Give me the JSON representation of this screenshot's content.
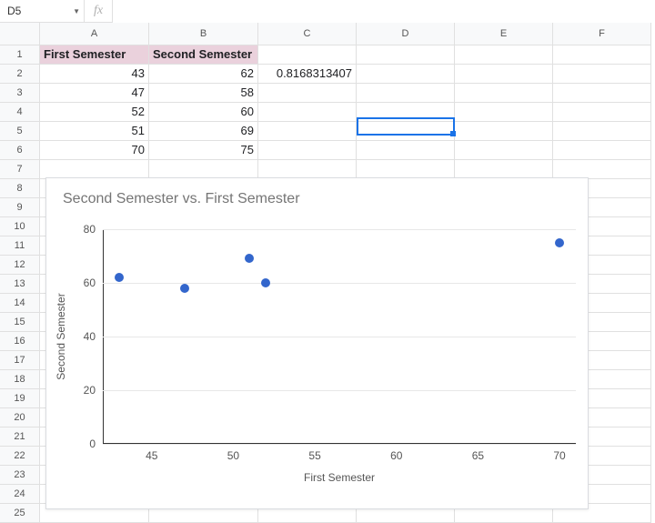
{
  "name_box": "D5",
  "fx_label": "fx",
  "formula": "",
  "columns": [
    "A",
    "B",
    "C",
    "D",
    "E",
    "F"
  ],
  "row_count": 25,
  "headers": {
    "A": "First Semester",
    "B": "Second Semester"
  },
  "data": {
    "r2": {
      "A": "43",
      "B": "62",
      "C": "0.8168313407"
    },
    "r3": {
      "A": "47",
      "B": "58"
    },
    "r4": {
      "A": "52",
      "B": "60"
    },
    "r5": {
      "A": "51",
      "B": "69"
    },
    "r6": {
      "A": "70",
      "B": "75"
    }
  },
  "selected_cell": "D5",
  "chart_data": {
    "type": "scatter",
    "title": "Second Semester vs. First Semester",
    "xlabel": "First Semester",
    "ylabel": "Second Semester",
    "x": [
      43,
      47,
      52,
      51,
      70
    ],
    "y": [
      62,
      58,
      60,
      69,
      75
    ],
    "xlim": [
      42,
      71
    ],
    "ylim": [
      0,
      80
    ],
    "xticks": [
      45,
      50,
      55,
      60,
      65,
      70
    ],
    "yticks": [
      0,
      20,
      40,
      60,
      80
    ]
  }
}
